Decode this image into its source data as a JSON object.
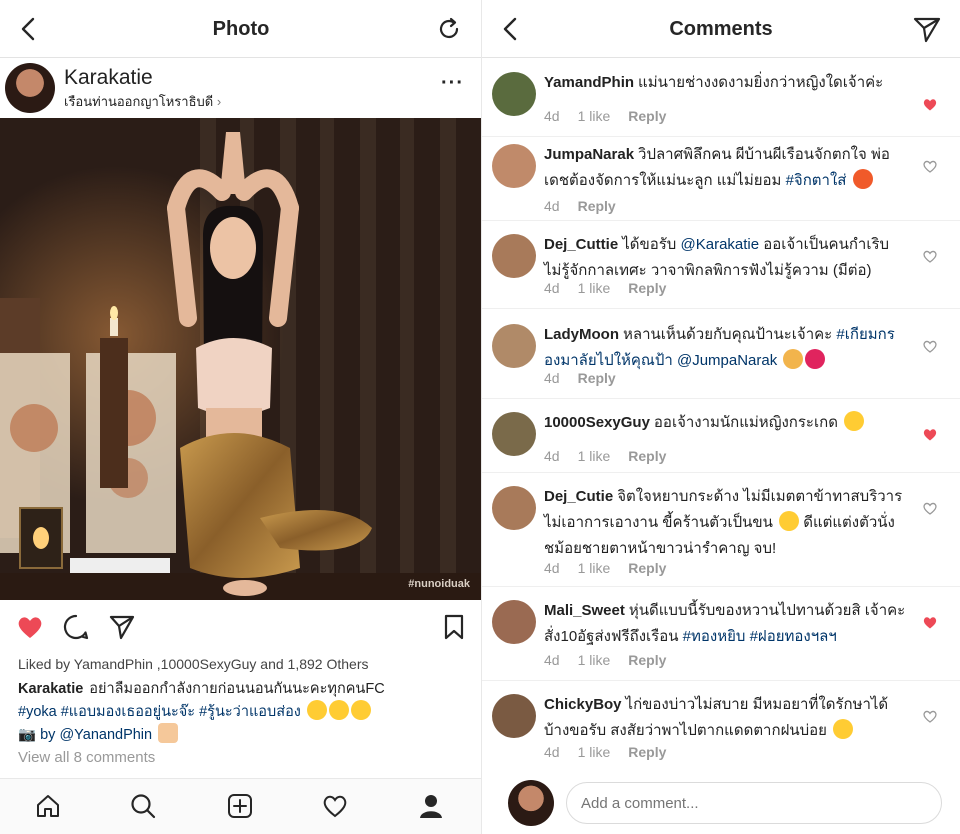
{
  "photo_screen": {
    "title": "Photo",
    "author": {
      "name": "Karakatie",
      "location": "เรือนท่านออกญาโหราธิบดี"
    },
    "watermark": "#nunoiduak",
    "liked_by": {
      "prefix": "Liked by ",
      "users": "YamandPhin ,10000SexyGuy",
      "suffix": " and 1,892 Others"
    },
    "caption": {
      "user": "Karakatie",
      "line1": "อย่าลืมออกกำลังกายก่อนนอนกันนะคะทุกคนFC",
      "hashtags": "#yoka #แอบมองเธออยู่นะจ๊ะ #รู้นะว่าแอบส่อง",
      "credit_by": "by ",
      "credit_user": "@YanandPhin"
    },
    "view_all": "View all 8 comments",
    "like_state": "liked",
    "accent_red": "#ed4956"
  },
  "comments_screen": {
    "title": "Comments",
    "comments": [
      {
        "user": "YamandPhin",
        "text": "แม่นายช่างงดงามยิ่งกว่าหญิงใดเจ้าค่ะ",
        "time": "4d",
        "likes": "1 like",
        "reply": "Reply",
        "liked": true
      },
      {
        "user": "JumpaNarak",
        "text": "วิปลาศพิลึกคน ผีบ้านผีเรือนจักตกใจ พ่อเดชต้องจัดการให้แม่นะลูก แม่ไม่ยอม",
        "tag": "#จิกตาใส่",
        "time": "4d",
        "likes": "",
        "reply": "Reply",
        "liked": false
      },
      {
        "user": "Dej_Cuttie",
        "text": "ได้ขอรับ",
        "mention": "@Karakatie",
        "text2": "ออเจ้าเป็นคนกำเริบ ไม่รู้จักกาลเทศะ วาจาพิกลพิการฟังไม่รู้ความ (มีต่อ)",
        "time": "4d",
        "likes": "1 like",
        "reply": "Reply",
        "liked": false
      },
      {
        "user": "LadyMoon",
        "text": "หลานเห็นด้วยกับคุณป้านะเจ้าคะ",
        "tag": "#เกียมกรองมาลัยไปให้คุณป้า",
        "mention": "@JumpaNarak",
        "time": "4d",
        "likes": "",
        "reply": "Reply",
        "liked": false
      },
      {
        "user": "10000SexyGuy",
        "text": "ออเจ้างามนักแม่หญิงกระเกด",
        "time": "4d",
        "likes": "1 like",
        "reply": "Reply",
        "liked": true
      },
      {
        "user": "Dej_Cutie",
        "text": "จิตใจหยาบกระด้าง ไม่มีเมตตาข้าทาสบริวาร ไม่เอาการเอางาน ขี้คร้านตัวเป็นขน",
        "text2": "ดีแต่แต่งตัวนั่งชม้อยชายตาหน้าขาวน่ารำคาญ จบ!",
        "time": "4d",
        "likes": "1 like",
        "reply": "Reply",
        "liked": false
      },
      {
        "user": "Mali_Sweet",
        "text": "หุ่นดีแบบนี้รับของหวานไปทานด้วยสิ เจ้าคะสั่ง10อัฐส่งฟรีถึงเรือน",
        "tag": "#ทองหยิบ #ฝอยทองฯลฯ",
        "time": "4d",
        "likes": "1 like",
        "reply": "Reply",
        "liked": true
      },
      {
        "user": "ChickyBoy",
        "text": "ไก่ของบ่าวไม่สบาย มีหมอยาที่ใดรักษาได้บ้างขอรับ สงสัยว่าพาไปตากแดดตากฝนบ่อย",
        "time": "4d",
        "likes": "1 like",
        "reply": "Reply",
        "liked": false
      }
    ],
    "add_comment_placeholder": "Add a comment..."
  },
  "icons": [
    "back-icon",
    "refresh-icon",
    "send-icon",
    "more-icon",
    "heart-icon",
    "comment-icon",
    "bookmark-icon",
    "home-icon",
    "search-icon",
    "add-icon",
    "activity-icon",
    "profile-icon",
    "camera-icon"
  ]
}
